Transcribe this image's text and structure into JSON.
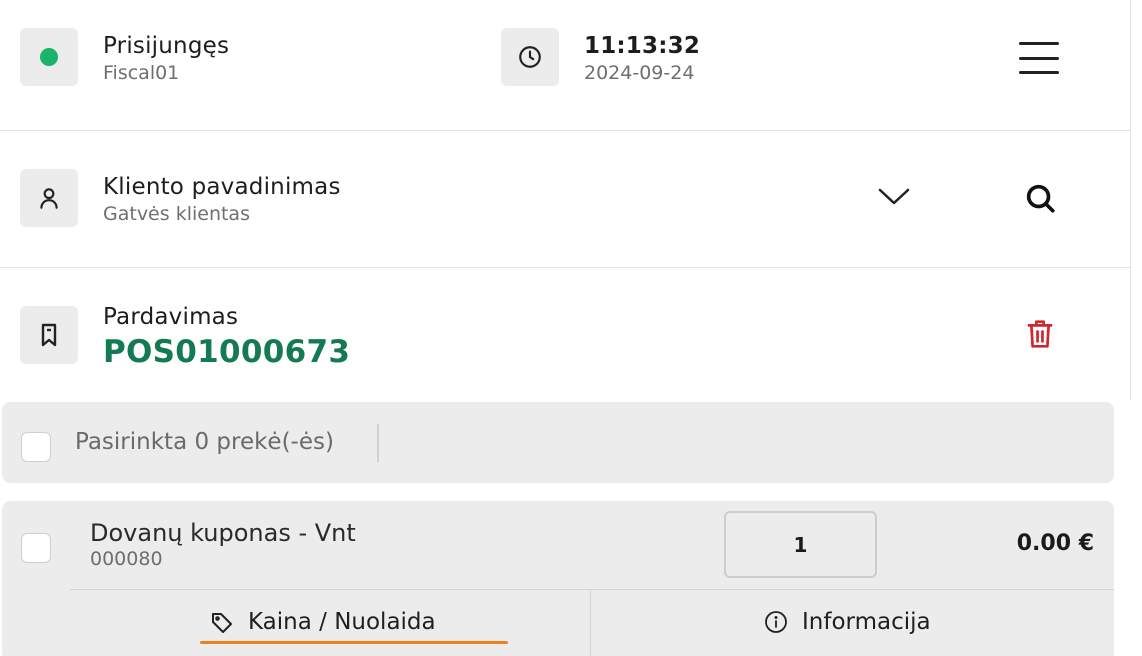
{
  "header": {
    "status_title": "Prisijungęs",
    "status_user": "Fiscal01",
    "time": "11:13:32",
    "date": "2024-09-24",
    "status_color": "#1bb26b"
  },
  "client": {
    "title": "Kliento pavadinimas",
    "name": "Gatvės klientas"
  },
  "sale": {
    "title": "Pardavimas",
    "number": "POS01000673",
    "number_color": "#147a52",
    "delete_color": "#d0272e"
  },
  "selection": {
    "label": "Pasirinkta 0 prekė(-ės)"
  },
  "items": [
    {
      "name": "Dovanų kuponas - Vnt",
      "code": "000080",
      "quantity": "1",
      "price": "0.00 €"
    }
  ],
  "item_actions": {
    "price_discount": "Kaina / Nuolaida",
    "info": "Informacija",
    "active_color": "#f07f1d"
  },
  "icons": [
    "status-dot",
    "clock-icon",
    "hamburger-menu-icon",
    "user-icon",
    "chevron-down-icon",
    "search-icon",
    "bookmark-icon",
    "trash-icon",
    "tag-icon",
    "info-icon"
  ]
}
